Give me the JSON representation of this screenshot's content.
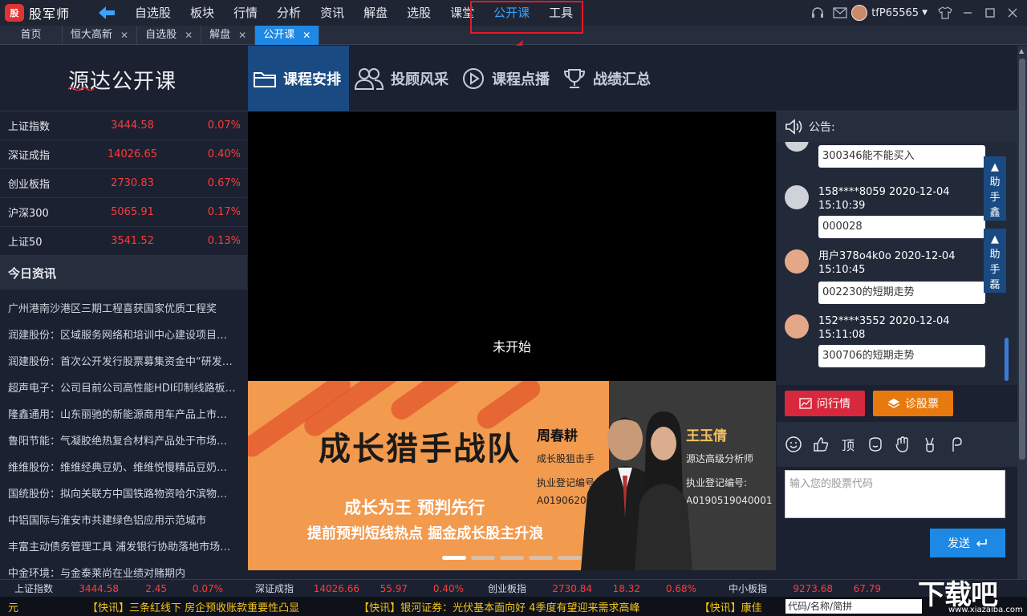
{
  "app": {
    "name": "股军师",
    "logo_mark": "股"
  },
  "menu": [
    "自选股",
    "板块",
    "行情",
    "分析",
    "资讯",
    "解盘",
    "选股",
    "课堂",
    "公开课",
    "工具"
  ],
  "menu_active_index": 8,
  "user": {
    "name": "tfP65565"
  },
  "tabs": [
    "首页",
    "恒大高新",
    "自选股",
    "解盘",
    "公开课"
  ],
  "course": {
    "logo": "源达公开课",
    "nav": [
      "课程安排",
      "投顾风采",
      "课程点播",
      "战绩汇总"
    ]
  },
  "indices": [
    {
      "name": "上证指数",
      "value": "3444.58",
      "pct": "0.07%"
    },
    {
      "name": "深证成指",
      "value": "14026.65",
      "pct": "0.40%"
    },
    {
      "name": "创业板指",
      "value": "2730.83",
      "pct": "0.67%"
    },
    {
      "name": "沪深300",
      "value": "5065.91",
      "pct": "0.17%"
    },
    {
      "name": "上证50",
      "value": "3541.52",
      "pct": "0.13%"
    }
  ],
  "news": {
    "title": "今日资讯",
    "items": [
      "广州港南沙港区三期工程喜获国家优质工程奖",
      "润建股份：区域服务网络和培训中心建设项目…",
      "润建股份：首次公开发行股票募集资金中“研发…",
      "超声电子：公司目前公司高性能HDI印制线路板…",
      "隆鑫通用：山东丽驰的新能源商用车产品上市…",
      "鲁阳节能：气凝胶绝热复合材料产品处于市场…",
      "维维股份：维维经典豆奶、维维悦慢精品豆奶…",
      "国统股份：拟向关联方中国铁路物资哈尔滨物…",
      "中铝国际与淮安市共建绿色铝应用示范城市",
      "丰富主动债务管理工具 浦发银行协助落地市场…",
      "中金环境：与金泰莱尚在业绩对赌期内"
    ]
  },
  "video": {
    "status": "未开始"
  },
  "banner": {
    "title": "成长猎手战队",
    "sub1": "成长为王 预判先行",
    "sub2": "提前预判短线热点 掘金成长股主升浪",
    "teacher1": {
      "name": "周春耕",
      "desc": "成长股狙击手",
      "label": "执业登记编号:",
      "num": "A0190620010001"
    },
    "teacher2": {
      "name": "王玉倩",
      "desc": "源达高级分析师",
      "label": "执业登记编号:",
      "num": "A0190519040001"
    },
    "slide_count": 5,
    "active_slide": 0
  },
  "chat": {
    "notice": "公告:",
    "messages": [
      {
        "who_line1": "",
        "who_line2": "",
        "text": "300346能不能买入"
      },
      {
        "who_line1": "158****8059 2020-12-04",
        "who_line2": "15:10:39",
        "text": "000028"
      },
      {
        "who_line1": "用户378o4k0o 2020-12-04",
        "who_line2": "15:10:45",
        "text": "002230的短期走势"
      },
      {
        "who_line1": "152****3552 2020-12-04",
        "who_line2": "15:11:08",
        "text": "300706的短期走势"
      }
    ],
    "assistants": [
      "助手鑫",
      "助手磊"
    ],
    "buttons": {
      "ask": "问行情",
      "diagnose": "诊股票"
    },
    "tools": [
      "顶"
    ],
    "input_placeholder": "输入您的股票代码",
    "send": "发送"
  },
  "ticker": [
    {
      "name": "上证指数",
      "value": "3444.58",
      "change": "2.45",
      "pct": "0.07%"
    },
    {
      "name": "深证成指",
      "value": "14026.66",
      "change": "55.97",
      "pct": "0.40%"
    },
    {
      "name": "创业板指",
      "value": "2730.84",
      "change": "18.32",
      "pct": "0.68%"
    },
    {
      "name": "中小板指",
      "value": "9273.68",
      "change": "67.79",
      "pct": ""
    }
  ],
  "newsbar": [
    "元",
    "【快讯】三条红线下 房企预收账款重要性凸显",
    "【快讯】银河证券：光伏基本面向好 4季度有望迎来需求高峰",
    "【快讯】康佳"
  ],
  "search_placeholder": "代码/名称/简拼",
  "watermark": {
    "big": "下载吧",
    "small": "www.xiazaiba.com"
  },
  "colors": {
    "up": "#ff3b3b",
    "accent": "#1e88e5",
    "highlight_box": "#e8172a",
    "news_ticker": "#f5c518"
  }
}
